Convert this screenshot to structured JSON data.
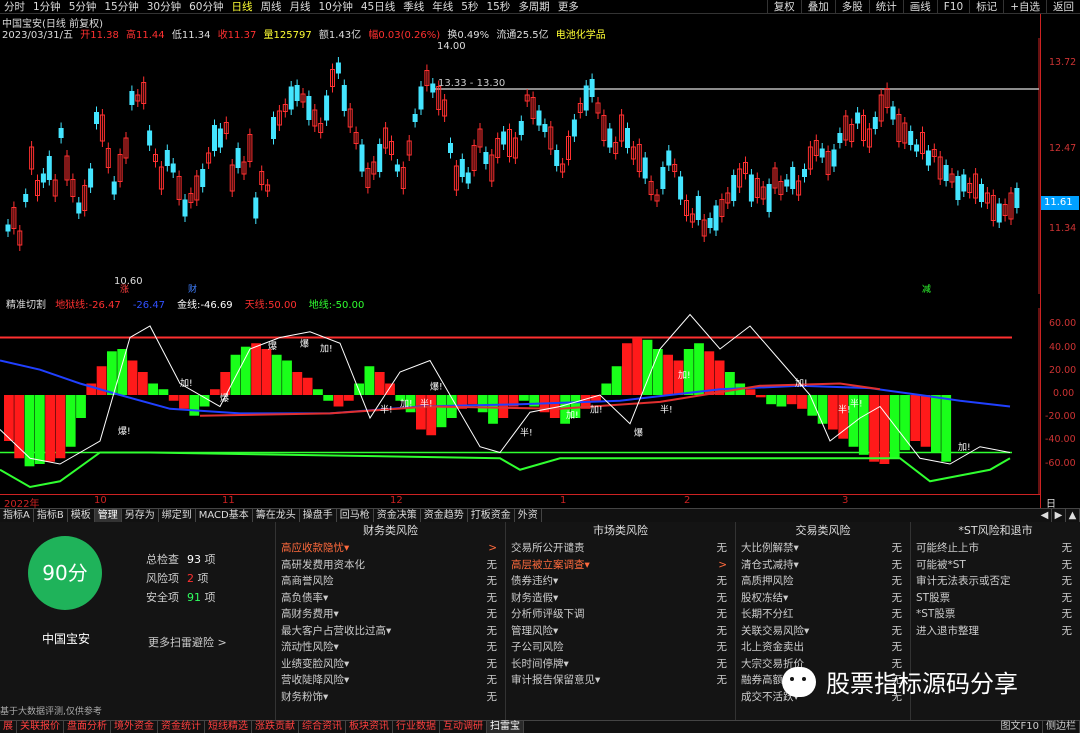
{
  "toolbar": {
    "periods": [
      "分时",
      "1分钟",
      "5分钟",
      "15分钟",
      "30分钟",
      "60分钟",
      "日线",
      "周线",
      "月线",
      "10分钟",
      "45日线",
      "季线",
      "年线",
      "5秒",
      "15秒",
      "多周期",
      "更多"
    ],
    "active_period": "日线",
    "tools": [
      "复权",
      "叠加",
      "多股",
      "统计",
      "画线",
      "F10",
      "标记",
      "+自选",
      "返回"
    ]
  },
  "stock": {
    "title": "中国宝安(日线 前复权)",
    "date": "2023/03/31/五",
    "open": "开11.38",
    "high": "高11.44",
    "low": "低11.34",
    "close": "收11.37",
    "volume": "量125797",
    "amount": "额1.43亿",
    "change": "幅0.03(0.26%)",
    "turnover": "换0.49%",
    "float": "流通25.5亿",
    "concept": "电池化学品"
  },
  "kline": {
    "price_labels": [
      "13.72",
      "12.47",
      "11.34"
    ],
    "current_price": "11.61",
    "max_label": "14.00",
    "min_label": "10.60",
    "range_label": "13.33 - 13.30",
    "markers": [
      "涨",
      "财",
      "减"
    ]
  },
  "indicator": {
    "name": "精准切割",
    "legend": [
      {
        "label": "地狱线:",
        "value": "-26.47",
        "color": "#ff3030"
      },
      {
        "label": "",
        "value": "-26.47",
        "color": "#3050ff"
      },
      {
        "label": "金线:",
        "value": "-46.69",
        "color": "#ffffff"
      },
      {
        "label": "天线:",
        "value": "50.00",
        "color": "#ff3030"
      },
      {
        "label": "地线:",
        "value": "-50.00",
        "color": "#30ff30"
      }
    ],
    "axis": [
      "60.00",
      "40.00",
      "20.00",
      "0.00",
      "-20.00",
      "-40.00",
      "-60.00"
    ],
    "annotations": [
      "爆!",
      "加!",
      "爆",
      "爆",
      "爆",
      "加!",
      "爆!",
      "半!",
      "加!",
      "半!",
      "半!",
      "加!",
      "加!",
      "爆",
      "半!",
      "加!",
      "加!",
      "半!",
      "加!",
      "半!"
    ]
  },
  "xaxis": {
    "labels": [
      "2022年",
      "10",
      "11",
      "12",
      "1",
      "2",
      "3"
    ],
    "right": "日线"
  },
  "tabs": [
    "指标A",
    "指标B",
    "模板",
    "管理",
    "另存为",
    "绑定到",
    "MACD基本",
    "籌在龙头",
    "操盘手",
    "回马枪",
    "资金决策",
    "资金趋势",
    "打板资金",
    "外资"
  ],
  "active_tab": "管理",
  "risk": {
    "score": "90分",
    "name": "中国宝安",
    "total_label": "总检查",
    "total_count": "93",
    "total_unit": "项",
    "risk_label": "风险项",
    "risk_count": "2",
    "risk_unit": "项",
    "safe_label": "安全项",
    "safe_count": "91",
    "safe_unit": "项",
    "more": "更多扫雷避险 >",
    "disclaimer": "基于大数据评测,仅供参考",
    "columns": [
      {
        "title": "财务类风险",
        "rows": [
          {
            "name": "高应收款隐忧▾",
            "val": ">",
            "hl": true
          },
          {
            "name": "高研发费用资本化",
            "val": "无"
          },
          {
            "name": "高商誉风险",
            "val": "无"
          },
          {
            "name": "高负债率▾",
            "val": "无"
          },
          {
            "name": "高财务费用▾",
            "val": "无"
          },
          {
            "name": "最大客户占营收比过高▾",
            "val": "无"
          },
          {
            "name": "流动性风险▾",
            "val": "无"
          },
          {
            "name": "业绩变脸风险▾",
            "val": "无"
          },
          {
            "name": "营收陡降风险▾",
            "val": "无"
          },
          {
            "name": "财务粉饰▾",
            "val": "无"
          }
        ]
      },
      {
        "title": "市场类风险",
        "rows": [
          {
            "name": "交易所公开谴责",
            "val": "无"
          },
          {
            "name": "高层被立案调查▾",
            "val": ">",
            "hl": true
          },
          {
            "name": "债券违约▾",
            "val": "无"
          },
          {
            "name": "财务造假▾",
            "val": "无"
          },
          {
            "name": "分析师评级下调",
            "val": "无"
          },
          {
            "name": "管理风险▾",
            "val": "无"
          },
          {
            "name": "子公司风险",
            "val": "无"
          },
          {
            "name": "长时间停牌▾",
            "val": "无"
          },
          {
            "name": "审计报告保留意见▾",
            "val": "无"
          }
        ]
      },
      {
        "title": "交易类风险",
        "rows": [
          {
            "name": "大比例解禁▾",
            "val": "无"
          },
          {
            "name": "清仓式减持▾",
            "val": "无"
          },
          {
            "name": "高质押风险",
            "val": "无"
          },
          {
            "name": "股权冻结▾",
            "val": "无"
          },
          {
            "name": "长期不分红",
            "val": "无"
          },
          {
            "name": "关联交易风险▾",
            "val": "无"
          },
          {
            "name": "北上资金卖出",
            "val": "无"
          },
          {
            "name": "大宗交易折价",
            "val": "无"
          },
          {
            "name": "融券高额",
            "val": "无"
          },
          {
            "name": "成交不活跃▾",
            "val": "无"
          }
        ]
      },
      {
        "title": "*ST风险和退市",
        "rows": [
          {
            "name": "可能终止上市",
            "val": "无"
          },
          {
            "name": "可能被*ST",
            "val": "无"
          },
          {
            "name": "审计无法表示或否定",
            "val": "无"
          },
          {
            "name": "ST股票",
            "val": "无"
          },
          {
            "name": "*ST股票",
            "val": "无"
          },
          {
            "name": "进入退市整理",
            "val": "无"
          }
        ]
      }
    ]
  },
  "statusbar": {
    "items": [
      "展",
      "关联报价",
      "盘面分析",
      "境外资金",
      "资金统计",
      "短线精选",
      "涨跌贡献",
      "综合资讯",
      "板块资讯",
      "行业数据",
      "互动调研",
      "扫雷宝"
    ],
    "active": "扫雷宝",
    "right": [
      "图文F10",
      "侧边栏"
    ]
  },
  "watermark": "股票指标源码分享",
  "colors": {
    "up": "#ff3030",
    "down": "#44e5ff",
    "bar_up": "#ff1a1a",
    "bar_down": "#1aff1a"
  }
}
